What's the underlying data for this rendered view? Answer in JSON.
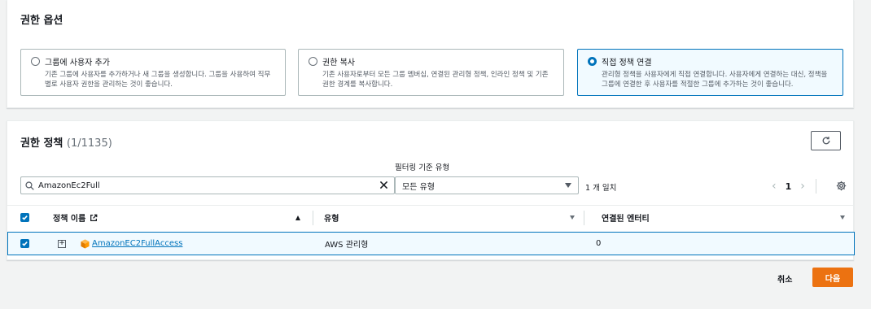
{
  "options": {
    "title": "권한 옵션",
    "tiles": [
      {
        "label": "그룹에 사용자 추가",
        "desc": "기존 그룹에 사용자를 추가하거나 새 그룹을 생성합니다. 그룹을 사용하여 직무 별로 사용자 권한을 관리하는 것이 좋습니다.",
        "selected": false
      },
      {
        "label": "권한 복사",
        "desc": "기존 사용자로부터 모든 그룹 멤버십, 연결된 관리형 정책, 인라인 정책 및 기존 권한 경계를 복사합니다.",
        "selected": false
      },
      {
        "label": "직접 정책 연결",
        "desc": "관리형 정책을 사용자에게 직접 연결합니다. 사용자에게 연결하는 대신, 정책을 그룹에 연결한 후 사용자를 적절한 그룹에 추가하는 것이 좋습니다.",
        "selected": true
      }
    ]
  },
  "policies": {
    "title": "권한 정책",
    "count": "(1/1135)",
    "search_value": "AmazonEc2Full",
    "filter_label": "필터링 기준 유형",
    "filter_value": "모든 유형",
    "match_text": "1 개 일치",
    "page": "1",
    "columns": {
      "name": "정책 이름",
      "type": "유형",
      "entities": "연결된 엔터티"
    },
    "rows": [
      {
        "name": "AmazonEC2FullAccess",
        "type": "AWS 관리형",
        "entities": "0",
        "selected": true
      }
    ]
  },
  "footer": {
    "cancel": "취소",
    "next": "다음"
  },
  "colors": {
    "accent": "#0073bb",
    "primary_button": "#ec7211",
    "selected_bg": "#f1faff"
  },
  "icons": [
    "radio-icon",
    "refresh-icon",
    "search-icon",
    "clear-icon",
    "caret-down-icon",
    "chevron-left-icon",
    "chevron-right-icon",
    "gear-icon",
    "checkbox-icon",
    "external-link-icon",
    "sort-up-icon",
    "sort-down-icon",
    "expand-icon",
    "aws-managed-cube-icon"
  ]
}
